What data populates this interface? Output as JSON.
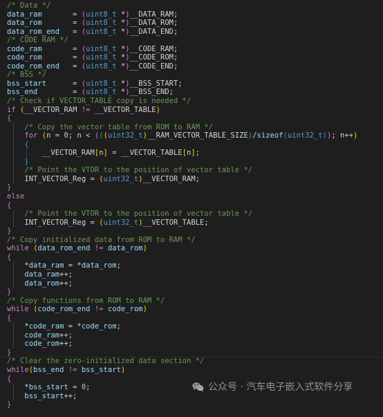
{
  "editor": {
    "theme": "dark-plus",
    "background": "#1e1e1e",
    "colors": {
      "foreground": "#d4d4d4",
      "comment": "#6a9955",
      "keyword": "#c586c0",
      "type": "#569cd6",
      "variable": "#9cdcfe",
      "number": "#b5cea8",
      "function": "#dcdcaa",
      "bracket_level_1": "#ffd700",
      "bracket_level_2": "#da70d6",
      "bracket_level_3": "#179fff",
      "indent_guide": "#404040",
      "highlight_line": "#262626"
    },
    "language": "c",
    "lines": [
      {
        "indent": 0,
        "tokens": [
          {
            "t": "/* Data */",
            "c": "cmt"
          }
        ]
      },
      {
        "indent": 0,
        "tokens": [
          {
            "t": "data_ram",
            "c": "var"
          },
          {
            "t": "       = ",
            "c": "pln"
          },
          {
            "t": "(",
            "c": "br2"
          },
          {
            "t": "uint8_t",
            "c": "typ"
          },
          {
            "t": " *",
            "c": "pln"
          },
          {
            "t": ")",
            "c": "br2"
          },
          {
            "t": "__DATA_RAM;",
            "c": "pln"
          }
        ]
      },
      {
        "indent": 0,
        "tokens": [
          {
            "t": "data_rom",
            "c": "var"
          },
          {
            "t": "       = ",
            "c": "pln"
          },
          {
            "t": "(",
            "c": "br2"
          },
          {
            "t": "uint8_t",
            "c": "typ"
          },
          {
            "t": " *",
            "c": "pln"
          },
          {
            "t": ")",
            "c": "br2"
          },
          {
            "t": "__DATA_ROM;",
            "c": "pln"
          }
        ]
      },
      {
        "indent": 0,
        "tokens": [
          {
            "t": "data_rom_end",
            "c": "var"
          },
          {
            "t": "   = ",
            "c": "pln"
          },
          {
            "t": "(",
            "c": "br2"
          },
          {
            "t": "uint8_t",
            "c": "typ"
          },
          {
            "t": " *",
            "c": "pln"
          },
          {
            "t": ")",
            "c": "br2"
          },
          {
            "t": "__DATA_END;",
            "c": "pln"
          }
        ]
      },
      {
        "indent": 0,
        "tokens": [
          {
            "t": "/* CODE RAM */",
            "c": "cmt"
          }
        ]
      },
      {
        "indent": 0,
        "tokens": [
          {
            "t": "code_ram",
            "c": "var"
          },
          {
            "t": "       = ",
            "c": "pln"
          },
          {
            "t": "(",
            "c": "br2"
          },
          {
            "t": "uint8_t",
            "c": "typ"
          },
          {
            "t": " *",
            "c": "pln"
          },
          {
            "t": ")",
            "c": "br2"
          },
          {
            "t": "__CODE_RAM;",
            "c": "pln"
          }
        ]
      },
      {
        "indent": 0,
        "tokens": [
          {
            "t": "code_rom",
            "c": "var"
          },
          {
            "t": "       = ",
            "c": "pln"
          },
          {
            "t": "(",
            "c": "br2"
          },
          {
            "t": "uint8_t",
            "c": "typ"
          },
          {
            "t": " *",
            "c": "pln"
          },
          {
            "t": ")",
            "c": "br2"
          },
          {
            "t": "__CODE_ROM;",
            "c": "pln"
          }
        ]
      },
      {
        "indent": 0,
        "tokens": [
          {
            "t": "code_rom_end",
            "c": "var"
          },
          {
            "t": "   = ",
            "c": "pln"
          },
          {
            "t": "(",
            "c": "br2"
          },
          {
            "t": "uint8_t",
            "c": "typ"
          },
          {
            "t": " *",
            "c": "pln"
          },
          {
            "t": ")",
            "c": "br2"
          },
          {
            "t": "__CODE_END;",
            "c": "pln"
          }
        ]
      },
      {
        "indent": 0,
        "tokens": [
          {
            "t": "/* BSS */",
            "c": "cmt"
          }
        ]
      },
      {
        "indent": 0,
        "tokens": [
          {
            "t": "bss_start",
            "c": "var"
          },
          {
            "t": "      = ",
            "c": "pln"
          },
          {
            "t": "(",
            "c": "br2"
          },
          {
            "t": "uint8_t",
            "c": "typ"
          },
          {
            "t": " *",
            "c": "pln"
          },
          {
            "t": ")",
            "c": "br2"
          },
          {
            "t": "__BSS_START;",
            "c": "pln"
          }
        ]
      },
      {
        "indent": 0,
        "tokens": [
          {
            "t": "bss_end",
            "c": "var"
          },
          {
            "t": "        = ",
            "c": "pln"
          },
          {
            "t": "(",
            "c": "br2"
          },
          {
            "t": "uint8_t",
            "c": "typ"
          },
          {
            "t": " *",
            "c": "pln"
          },
          {
            "t": ")",
            "c": "br2"
          },
          {
            "t": "__BSS_END;",
            "c": "pln"
          }
        ]
      },
      {
        "indent": 0,
        "tokens": [
          {
            "t": "/* Check if VECTOR_TABLE copy is needed */",
            "c": "cmt"
          }
        ]
      },
      {
        "indent": 0,
        "tokens": [
          {
            "t": "if",
            "c": "kw"
          },
          {
            "t": " ",
            "c": "pln"
          },
          {
            "t": "(",
            "c": "br1"
          },
          {
            "t": "__VECTOR_RAM ",
            "c": "pln"
          },
          {
            "t": "!=",
            "c": "kw"
          },
          {
            "t": " __VECTOR_TABLE",
            "c": "pln"
          },
          {
            "t": ")",
            "c": "br1"
          }
        ]
      },
      {
        "indent": 0,
        "tokens": [
          {
            "t": "{",
            "c": "br2"
          }
        ]
      },
      {
        "indent": 1,
        "guides": 1,
        "tokens": [
          {
            "t": "/* Copy the vector table from ROM to RAM */",
            "c": "cmt"
          }
        ]
      },
      {
        "indent": 1,
        "guides": 1,
        "tokens": [
          {
            "t": "for",
            "c": "kw"
          },
          {
            "t": " ",
            "c": "pln"
          },
          {
            "t": "(",
            "c": "br1"
          },
          {
            "t": "n = ",
            "c": "pln"
          },
          {
            "t": "0",
            "c": "num"
          },
          {
            "t": "; n < ",
            "c": "pln"
          },
          {
            "t": "(",
            "c": "br2"
          },
          {
            "t": "(",
            "c": "br3"
          },
          {
            "t": "(",
            "c": "br1"
          },
          {
            "t": "uint32_t",
            "c": "typ"
          },
          {
            "t": ")",
            "c": "br1"
          },
          {
            "t": "__RAM_VECTOR_TABLE_SIZE",
            "c": "pln"
          },
          {
            "t": ")",
            "c": "br3"
          },
          {
            "t": "/",
            "c": "pln"
          },
          {
            "t": "sizeof",
            "c": "var"
          },
          {
            "t": "(",
            "c": "br3"
          },
          {
            "t": "uint32_t",
            "c": "typ"
          },
          {
            "t": ")",
            "c": "br3"
          },
          {
            "t": ")",
            "c": "br2"
          },
          {
            "t": "; n++",
            "c": "pln"
          },
          {
            "t": ")",
            "c": "br1"
          }
        ]
      },
      {
        "indent": 1,
        "guides": 1,
        "tokens": [
          {
            "t": "{",
            "c": "br3"
          }
        ]
      },
      {
        "indent": 2,
        "guides": 2,
        "tokens": [
          {
            "t": "__VECTOR_RAM",
            "c": "pln"
          },
          {
            "t": "[",
            "c": "br1"
          },
          {
            "t": "n",
            "c": "pln"
          },
          {
            "t": "]",
            "c": "br1"
          },
          {
            "t": " = __VECTOR_TABLE",
            "c": "pln"
          },
          {
            "t": "[",
            "c": "br1"
          },
          {
            "t": "n",
            "c": "pln"
          },
          {
            "t": "]",
            "c": "br1"
          },
          {
            "t": ";",
            "c": "pln"
          }
        ]
      },
      {
        "indent": 1,
        "guides": 1,
        "tokens": [
          {
            "t": "}",
            "c": "br3"
          }
        ]
      },
      {
        "indent": 1,
        "guides": 1,
        "tokens": [
          {
            "t": "/* Point the VTOR to the position of vector table */",
            "c": "cmt"
          }
        ]
      },
      {
        "indent": 1,
        "guides": 1,
        "tokens": [
          {
            "t": "INT_VECTOR_Reg = ",
            "c": "pln"
          },
          {
            "t": "(",
            "c": "br1"
          },
          {
            "t": "uint32_t",
            "c": "typ"
          },
          {
            "t": ")",
            "c": "br1"
          },
          {
            "t": "__VECTOR_RAM;",
            "c": "pln"
          }
        ]
      },
      {
        "indent": 0,
        "tokens": [
          {
            "t": "}",
            "c": "br2"
          }
        ]
      },
      {
        "indent": 0,
        "tokens": [
          {
            "t": "else",
            "c": "kw"
          }
        ]
      },
      {
        "indent": 0,
        "tokens": [
          {
            "t": "{",
            "c": "br2"
          }
        ]
      },
      {
        "indent": 1,
        "guides": 1,
        "tokens": [
          {
            "t": "/* Point the VTOR to the position of vector table */",
            "c": "cmt"
          }
        ]
      },
      {
        "indent": 1,
        "guides": 1,
        "tokens": [
          {
            "t": "INT_VECTOR_Reg = ",
            "c": "pln"
          },
          {
            "t": "(",
            "c": "br1"
          },
          {
            "t": "uint32_t",
            "c": "typ"
          },
          {
            "t": ")",
            "c": "br1"
          },
          {
            "t": "__VECTOR_TABLE;",
            "c": "pln"
          }
        ]
      },
      {
        "indent": 0,
        "tokens": [
          {
            "t": "}",
            "c": "br2"
          }
        ]
      },
      {
        "indent": 0,
        "tokens": [
          {
            "t": "/* Copy initialized data from ROM to RAM */",
            "c": "cmt"
          }
        ]
      },
      {
        "indent": 0,
        "tokens": [
          {
            "t": "while",
            "c": "kw"
          },
          {
            "t": " ",
            "c": "pln"
          },
          {
            "t": "(",
            "c": "br1"
          },
          {
            "t": "data_rom_end",
            "c": "var"
          },
          {
            "t": " ",
            "c": "pln"
          },
          {
            "t": "!=",
            "c": "kw"
          },
          {
            "t": " ",
            "c": "pln"
          },
          {
            "t": "data_rom",
            "c": "var"
          },
          {
            "t": ")",
            "c": "br1"
          }
        ]
      },
      {
        "indent": 0,
        "tokens": [
          {
            "t": "{",
            "c": "br2"
          }
        ]
      },
      {
        "indent": 1,
        "guides": 1,
        "tokens": [
          {
            "t": "*",
            "c": "pln"
          },
          {
            "t": "data_ram",
            "c": "var"
          },
          {
            "t": " = *",
            "c": "pln"
          },
          {
            "t": "data_rom",
            "c": "var"
          },
          {
            "t": ";",
            "c": "pln"
          }
        ]
      },
      {
        "indent": 1,
        "guides": 1,
        "tokens": [
          {
            "t": "data_ram",
            "c": "var"
          },
          {
            "t": "++;",
            "c": "pln"
          }
        ]
      },
      {
        "indent": 1,
        "guides": 1,
        "tokens": [
          {
            "t": "data_rom",
            "c": "var"
          },
          {
            "t": "++;",
            "c": "pln"
          }
        ]
      },
      {
        "indent": 0,
        "tokens": [
          {
            "t": "}",
            "c": "br2"
          }
        ]
      },
      {
        "indent": 0,
        "tokens": [
          {
            "t": "/* Copy functions from ROM to RAM */",
            "c": "cmt"
          }
        ]
      },
      {
        "indent": 0,
        "tokens": [
          {
            "t": "while",
            "c": "kw"
          },
          {
            "t": " ",
            "c": "pln"
          },
          {
            "t": "(",
            "c": "br1"
          },
          {
            "t": "code_rom_end",
            "c": "var"
          },
          {
            "t": " ",
            "c": "pln"
          },
          {
            "t": "!=",
            "c": "kw"
          },
          {
            "t": " ",
            "c": "pln"
          },
          {
            "t": "code_rom",
            "c": "var"
          },
          {
            "t": ")",
            "c": "br1"
          }
        ]
      },
      {
        "indent": 0,
        "tokens": [
          {
            "t": "{",
            "c": "br2"
          }
        ]
      },
      {
        "indent": 1,
        "guides": 1,
        "tokens": [
          {
            "t": "*",
            "c": "pln"
          },
          {
            "t": "code_ram",
            "c": "var"
          },
          {
            "t": " = *",
            "c": "pln"
          },
          {
            "t": "code_rom",
            "c": "var"
          },
          {
            "t": ";",
            "c": "pln"
          }
        ]
      },
      {
        "indent": 1,
        "guides": 1,
        "tokens": [
          {
            "t": "code_ram",
            "c": "var"
          },
          {
            "t": "++;",
            "c": "pln"
          }
        ]
      },
      {
        "indent": 1,
        "guides": 1,
        "tokens": [
          {
            "t": "code_rom",
            "c": "var"
          },
          {
            "t": "++;",
            "c": "pln"
          }
        ]
      },
      {
        "indent": 0,
        "tokens": [
          {
            "t": "}",
            "c": "br2"
          }
        ]
      },
      {
        "indent": 0,
        "divider": true,
        "tokens": [
          {
            "t": "/* Clear the zero-initialized data section */",
            "c": "cmt"
          }
        ]
      },
      {
        "indent": 0,
        "tokens": [
          {
            "t": "while",
            "c": "kw"
          },
          {
            "t": "(",
            "c": "br1"
          },
          {
            "t": "bss_end",
            "c": "var"
          },
          {
            "t": " ",
            "c": "pln"
          },
          {
            "t": "!=",
            "c": "kw"
          },
          {
            "t": " ",
            "c": "pln"
          },
          {
            "t": "bss_start",
            "c": "var"
          },
          {
            "t": ")",
            "c": "br1"
          }
        ]
      },
      {
        "indent": 0,
        "tokens": [
          {
            "t": "{",
            "c": "br2"
          }
        ]
      },
      {
        "indent": 1,
        "guides": 1,
        "tokens": [
          {
            "t": "*",
            "c": "pln"
          },
          {
            "t": "bss_start",
            "c": "var"
          },
          {
            "t": " = ",
            "c": "pln"
          },
          {
            "t": "0",
            "c": "num"
          },
          {
            "t": ";",
            "c": "pln"
          }
        ]
      },
      {
        "indent": 1,
        "guides": 1,
        "tokens": [
          {
            "t": "bss_start",
            "c": "var"
          },
          {
            "t": "++;",
            "c": "pln"
          }
        ]
      },
      {
        "indent": 0,
        "tokens": [
          {
            "t": "}",
            "c": "br2"
          }
        ]
      }
    ]
  },
  "watermark": {
    "icon": "wechat-icon",
    "text": "公众号 · 汽车电子嵌入式软件分享"
  }
}
